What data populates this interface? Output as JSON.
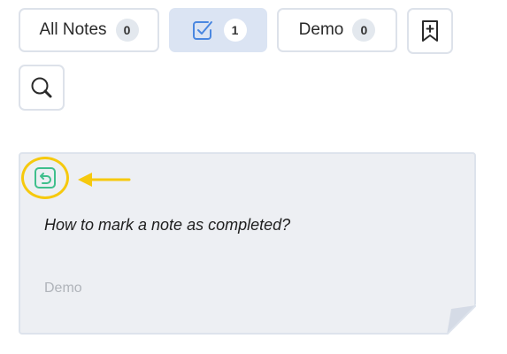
{
  "filters": [
    {
      "label": "All Notes",
      "count": "0"
    },
    {
      "label": "",
      "count": "1",
      "icon": "checkbox-icon"
    },
    {
      "label": "Demo",
      "count": "0"
    }
  ],
  "icons": {
    "add_note": "bookmark-plus-icon",
    "search": "search-icon",
    "restore": "restore-icon",
    "pointer": "arrow-left-icon"
  },
  "note": {
    "text": "How to mark a note as completed?",
    "tag": "Demo"
  },
  "colors": {
    "accent": "#4a87e0",
    "highlight": "#f6c90e",
    "restore_icon": "#3fbf8c"
  }
}
